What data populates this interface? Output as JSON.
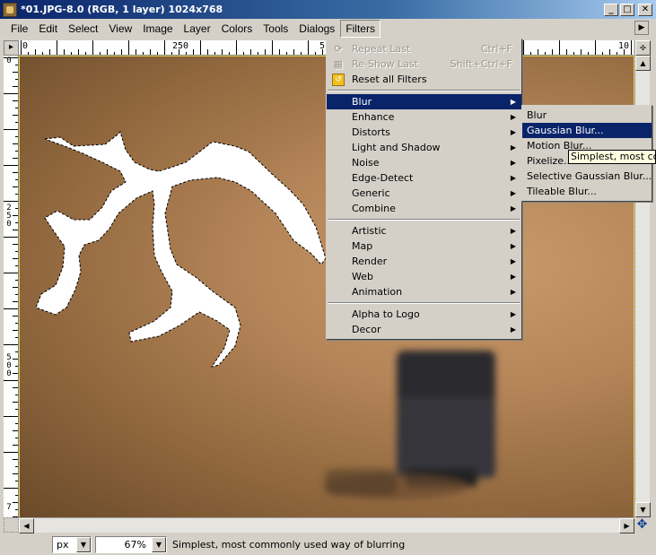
{
  "window": {
    "title": "*01.JPG-8.0 (RGB, 1 layer) 1024x768",
    "minimize_glyph": "_",
    "maximize_glyph": "□",
    "close_glyph": "✕"
  },
  "menubar": {
    "items": [
      "File",
      "Edit",
      "Select",
      "View",
      "Image",
      "Layer",
      "Colors",
      "Tools",
      "Dialogs",
      "Filters"
    ],
    "active": "Filters"
  },
  "rulers": {
    "h_labels": [
      "0",
      "250",
      "5",
      "10"
    ],
    "v_labels": [
      "0",
      "250",
      "500",
      "7"
    ]
  },
  "filters_menu": {
    "top_items": [
      {
        "label": "Repeat Last",
        "accel": "Ctrl+F",
        "disabled": true,
        "icon": "repeat-icon"
      },
      {
        "label": "Re-Show Last",
        "accel": "Shift+Ctrl+F",
        "disabled": true,
        "icon": "reshow-icon"
      },
      {
        "label": "Reset all Filters",
        "accel": "",
        "disabled": false,
        "icon": "reset-icon"
      }
    ],
    "group1": [
      "Blur",
      "Enhance",
      "Distorts",
      "Light and Shadow",
      "Noise",
      "Edge-Detect",
      "Generic",
      "Combine"
    ],
    "group2": [
      "Artistic",
      "Map",
      "Render",
      "Web",
      "Animation"
    ],
    "group3": [
      "Alpha to Logo",
      "Decor"
    ],
    "highlighted": "Blur"
  },
  "blur_menu": {
    "items": [
      "Blur",
      "Gaussian Blur...",
      "Motion Blur...",
      "Pixelize...",
      "Selective Gaussian Blur...",
      "Tileable Blur..."
    ],
    "highlighted": "Gaussian Blur..."
  },
  "tooltip": {
    "text": "Simplest, most comm"
  },
  "statusbar": {
    "unit": "px",
    "zoom": "67%",
    "message": "Simplest, most commonly used way of blurring"
  },
  "colors": {
    "titlebar": "#0a246a",
    "highlight": "#0a246a",
    "selection_border": "#e8d000",
    "tooltip_bg": "#ffffe1"
  }
}
